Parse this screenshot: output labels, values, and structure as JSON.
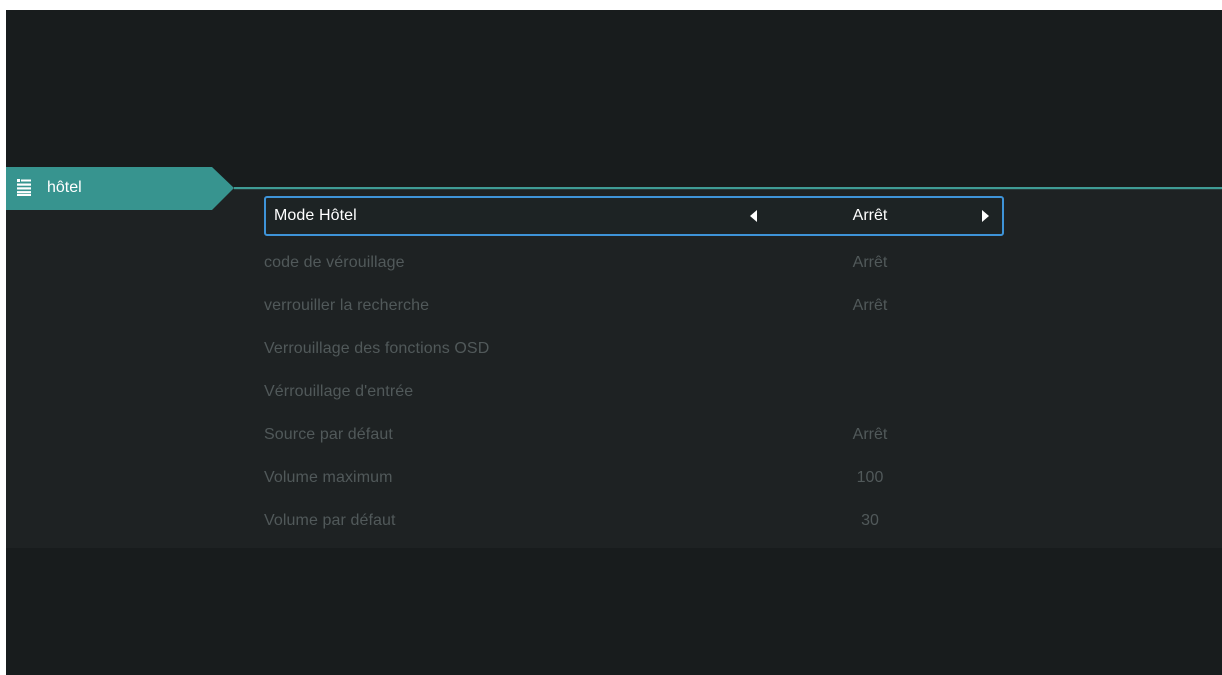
{
  "category": {
    "label": "hôtel",
    "icon": "menu-list-icon",
    "color": "#37948f"
  },
  "menu": {
    "items": [
      {
        "label": "Mode Hôtel",
        "value": "Arrêt",
        "selected": true
      },
      {
        "label": "code de vérouillage",
        "value": "Arrêt",
        "selected": false
      },
      {
        "label": "verrouiller la recherche",
        "value": "Arrêt",
        "selected": false
      },
      {
        "label": "Verrouillage des fonctions OSD",
        "value": "",
        "selected": false
      },
      {
        "label": "Vérrouillage d'entrée",
        "value": "",
        "selected": false
      },
      {
        "label": "Source par défaut",
        "value": "Arrêt",
        "selected": false
      },
      {
        "label": "Volume maximum",
        "value": "100",
        "selected": false
      },
      {
        "label": "Volume par défaut",
        "value": "30",
        "selected": false
      }
    ]
  },
  "colors": {
    "background": "#181c1d",
    "panel": "#1e2223",
    "accent": "#37948f",
    "focus_border": "#3e93d8",
    "dim_text": "#51595a",
    "active_text": "#ffffff"
  }
}
